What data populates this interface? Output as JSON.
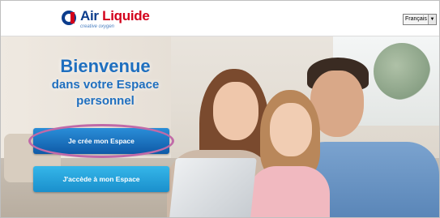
{
  "header": {
    "brand_part1": "Air",
    "brand_part2": "Liquide",
    "tagline": "creative oxygen",
    "language": {
      "selected": "Français"
    }
  },
  "hero": {
    "title_line1": "Bienvenue",
    "title_line2": "dans votre Espace",
    "title_line3": "personnel",
    "create_button": "Je crée mon Espace",
    "access_button": "J'accède à mon Espace"
  },
  "colors": {
    "brand_red": "#d3001b",
    "brand_blue": "#0b3c8c",
    "headline_blue": "#1f6fbf",
    "highlight_ring": "#c06aa8"
  },
  "icons": {
    "logo": "air-liquide-logo-icon",
    "select_arrow": "chevron-down-icon"
  }
}
